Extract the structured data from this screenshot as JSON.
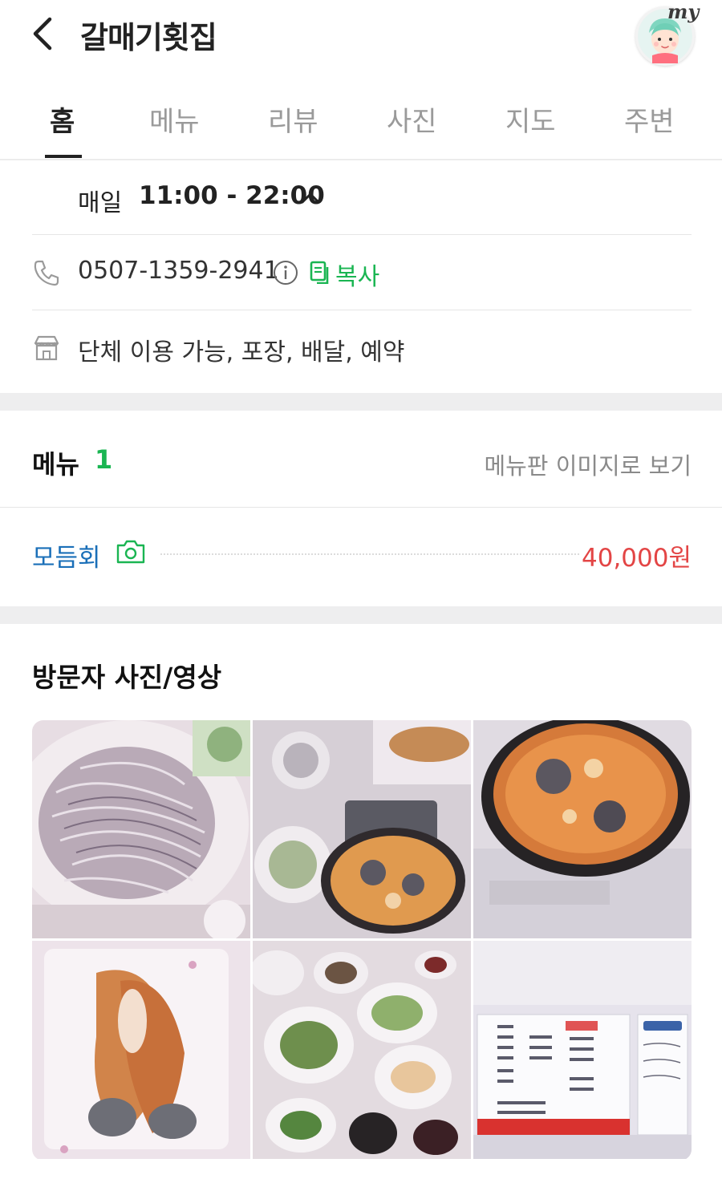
{
  "header": {
    "title": "갈매기횟집",
    "avatar_badge": "my"
  },
  "tabs": [
    {
      "label": "홈",
      "active": true
    },
    {
      "label": "메뉴",
      "active": false
    },
    {
      "label": "리뷰",
      "active": false
    },
    {
      "label": "사진",
      "active": false
    },
    {
      "label": "지도",
      "active": false
    },
    {
      "label": "주변",
      "active": false
    }
  ],
  "info": {
    "hours_day": "매일",
    "hours_time": "11:00 - 22:00",
    "phone": "0507-1359-2941",
    "copy_label": "복사",
    "amenities": "단체 이용 가능, 포장, 배달, 예약"
  },
  "menu": {
    "title": "메뉴",
    "count": "1",
    "view_board": "메뉴판 이미지로 보기",
    "items": [
      {
        "name": "모듬회",
        "price": "40,000원",
        "has_photo": true
      }
    ]
  },
  "photos": {
    "title": "방문자 사진/영상"
  },
  "colors": {
    "accent_green": "#1ab552",
    "menu_link_blue": "#1a6fb8",
    "price_red": "#e34545",
    "section_gap": "#eeeeef"
  },
  "icons": [
    "back-icon",
    "avatar",
    "chevron-up-icon",
    "phone-icon",
    "info-icon",
    "copy-icon",
    "store-icon",
    "camera-icon"
  ]
}
